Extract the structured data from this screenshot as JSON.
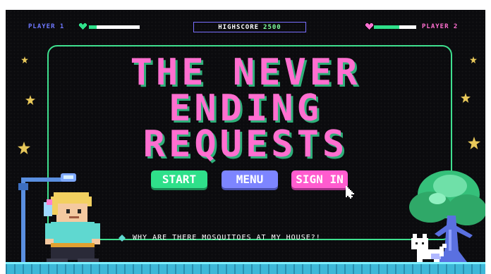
{
  "hud": {
    "player1_label": "PLAYER 1",
    "player2_label": "PLAYER 2",
    "player1_health": 0.15,
    "player2_health": 0.6,
    "highscore_label": "HIGHSCORE",
    "highscore_value": "2500"
  },
  "title": {
    "line1": "THE NEVER",
    "line2": "ENDING",
    "line3": "REQUESTS"
  },
  "buttons": {
    "start": "START",
    "menu": "MENU",
    "signin": "SIGN IN"
  },
  "ticker": {
    "text": "WHY ARE THERE MOSQUITOES AT MY HOUSE?!"
  },
  "colors": {
    "background": "#0b0b0e",
    "pink": "#ff6fd0",
    "green": "#2fe08a",
    "purple": "#7d85ff",
    "frame": "#3fe08f",
    "star": "#e8c85a"
  },
  "icons": [
    "heart-icon",
    "cursor-arrow-icon",
    "diamond-icon",
    "star-icon"
  ]
}
